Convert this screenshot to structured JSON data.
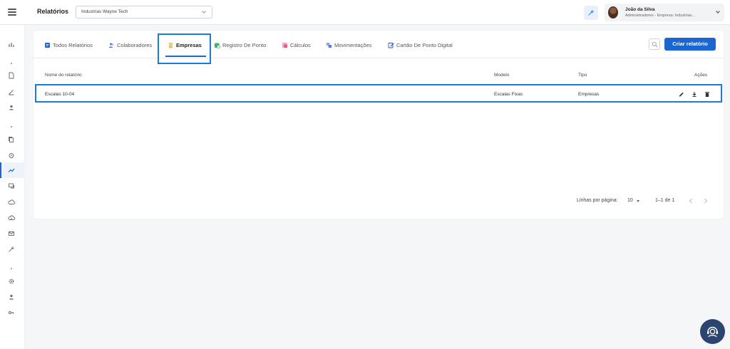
{
  "header": {
    "title": "Relatórios",
    "company_select": "Industrias Wayne Tech",
    "user_name": "João da Silva",
    "user_role": "Administradores - Empresa: Industrias..."
  },
  "tabs": [
    {
      "label": "Todos Relatórios",
      "icon": "document-icon"
    },
    {
      "label": "Colaboradores",
      "icon": "people-icon"
    },
    {
      "label": "Empresas",
      "icon": "building-icon"
    },
    {
      "label": "Registro De Ponto",
      "icon": "clock-register-icon"
    },
    {
      "label": "Cálculos",
      "icon": "calculator-icon"
    },
    {
      "label": "Movimentações",
      "icon": "transfer-icon"
    },
    {
      "label": "Cartão De Ponto Digital",
      "icon": "card-edit-icon"
    }
  ],
  "actions": {
    "create": "Criar relatório"
  },
  "table": {
    "headers": [
      "Nome do relatório",
      "Modelo",
      "Tipo",
      "Ações"
    ],
    "rows": [
      {
        "nome": "Escalas 10-04",
        "modelo": "Escalas Fixas",
        "tipo": "Empresas"
      }
    ]
  },
  "pagination": {
    "label": "Linhas por página:",
    "rows_per_page": "10",
    "range": "1–1 de 1"
  },
  "colors": {
    "accent": "#1a66d2",
    "highlight": "#1a7ae0",
    "fab": "#2b4470"
  }
}
